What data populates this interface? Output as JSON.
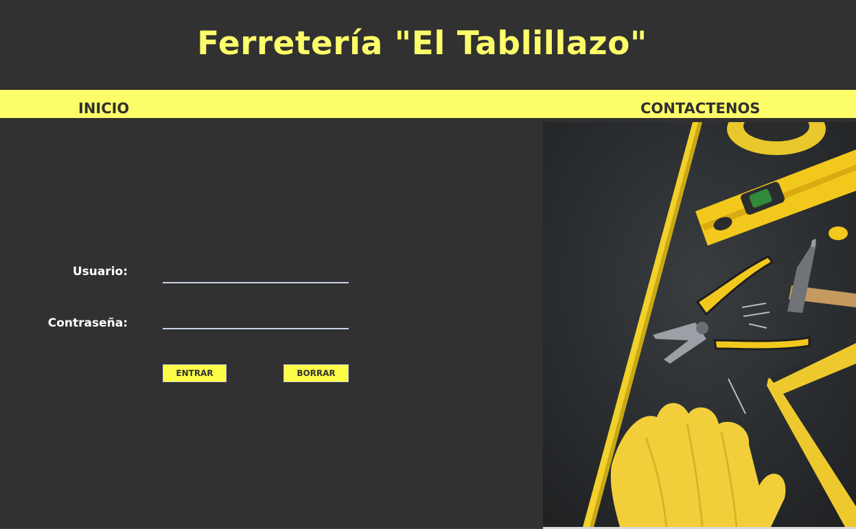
{
  "header": {
    "title": "Ferretería \"El Tablillazo\""
  },
  "nav": {
    "inicio": "INICIO",
    "contactenos": "CONTACTENOS"
  },
  "login": {
    "user_label": "Usuario:",
    "user_value": "",
    "pass_label": "Contraseña:",
    "pass_value": "",
    "submit_label": "ENTRAR",
    "clear_label": "BORRAR"
  },
  "image": {
    "semantic": "hardware-tools-photo"
  },
  "colors": {
    "accent": "#fdfd6a",
    "background": "#313131",
    "button": "#fdfd47",
    "text_dark": "#2f2f2f"
  }
}
